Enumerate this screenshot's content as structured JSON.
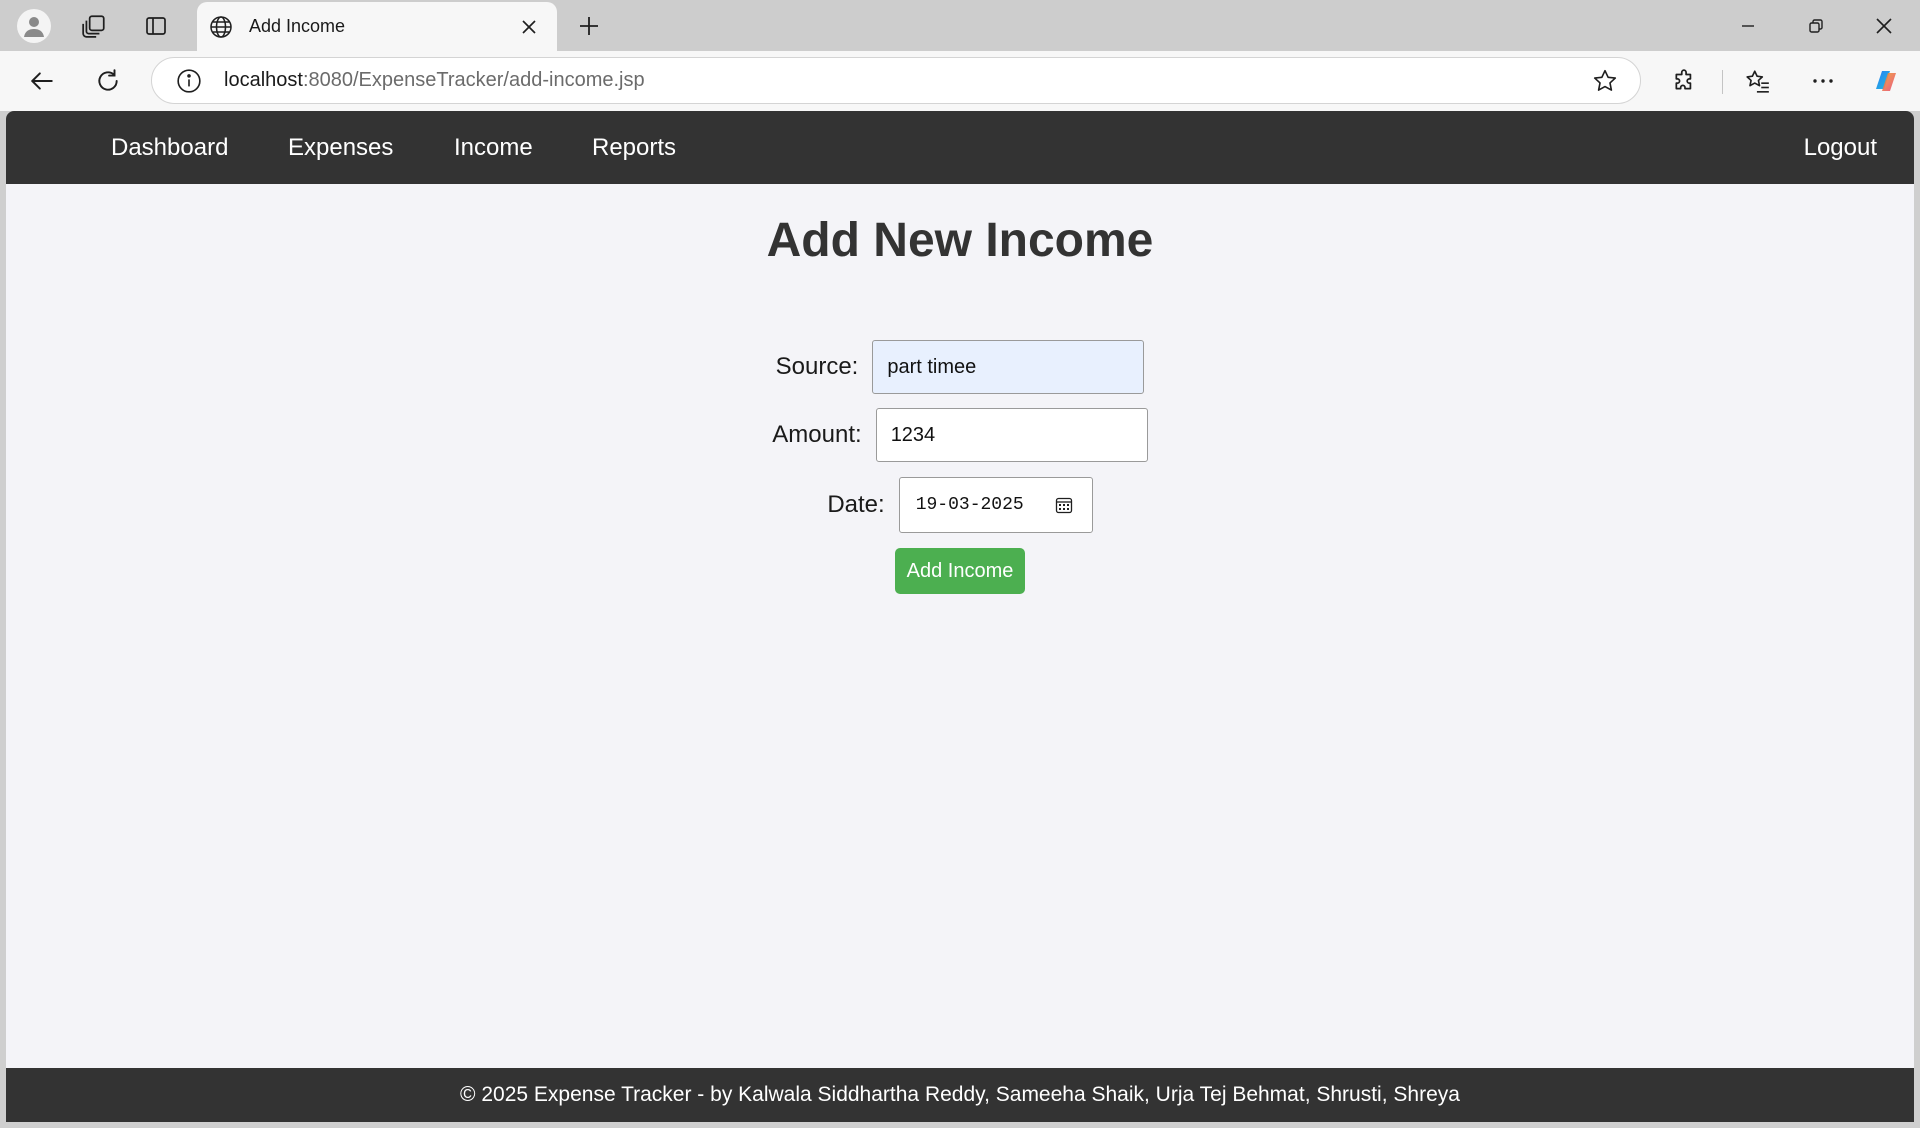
{
  "browser": {
    "tab_title": "Add Income",
    "url_host": "localhost",
    "url_path": ":8080/ExpenseTracker/add-income.jsp"
  },
  "nav": {
    "dashboard": "Dashboard",
    "expenses": "Expenses",
    "income": "Income",
    "reports": "Reports",
    "logout": "Logout"
  },
  "page": {
    "title": "Add New Income"
  },
  "form": {
    "source_label": "Source:",
    "source_value": "part timee",
    "amount_label": "Amount:",
    "amount_value": "1234",
    "date_label": "Date:",
    "date_value": "19-03-2025",
    "submit_label": "Add Income"
  },
  "footer": {
    "text": "© 2025 Expense Tracker - by Kalwala Siddhartha Reddy, Sameeha Shaik, Urja Tej Behmat, Shrusti, Shreya"
  },
  "colors": {
    "navbar_bg": "#333333",
    "page_bg": "#f4f4f8",
    "submit_bg": "#4caf50",
    "autofill_bg": "#e8f0fe"
  }
}
